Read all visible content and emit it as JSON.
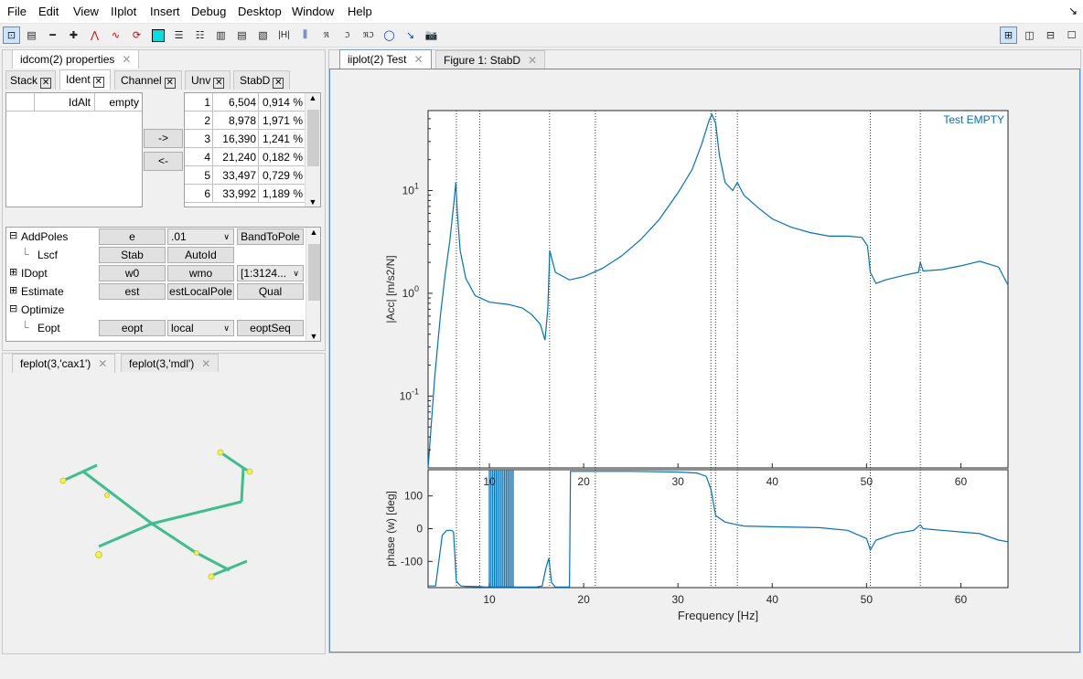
{
  "menu": [
    "File",
    "Edit",
    "View",
    "IIplot",
    "Insert",
    "Debug",
    "Desktop",
    "Window",
    "Help"
  ],
  "menu_underline_letters": [
    "F",
    "E",
    "V",
    "I",
    "I",
    "b",
    "D",
    "W",
    "H"
  ],
  "left_tabs": {
    "main": "idcom(2) properties"
  },
  "sub_tabs": [
    "Stack",
    "Ident",
    "Channel",
    "Unv",
    "StabD"
  ],
  "ident": {
    "header_col1": "IdAlt",
    "header_col2": "empty",
    "move_right": "->",
    "move_left": "<-",
    "poles": [
      {
        "idx": "1",
        "freq": "6,504",
        "damp": "0,914 %"
      },
      {
        "idx": "2",
        "freq": "8,978",
        "damp": "1,971 %"
      },
      {
        "idx": "3",
        "freq": "16,390",
        "damp": "1,241 %"
      },
      {
        "idx": "4",
        "freq": "21,240",
        "damp": "0,182 %"
      },
      {
        "idx": "5",
        "freq": "33,497",
        "damp": "0,729 %"
      },
      {
        "idx": "6",
        "freq": "33,992",
        "damp": "1,189 %"
      }
    ]
  },
  "tree": {
    "rows": [
      {
        "label": "AddPoles",
        "c1": "e",
        "c2": ".01",
        "c3": "BandToPole"
      },
      {
        "label": "Lscf",
        "c1": "Stab",
        "c2": "AutoId",
        "c3": ""
      },
      {
        "label": "IDopt",
        "c1": "w0",
        "c2": "wmo",
        "c3": "[1:3124..."
      },
      {
        "label": "Estimate",
        "c1": "est",
        "c2": "estLocalPole",
        "c3": "Qual"
      },
      {
        "label": "Optimize",
        "c1": "",
        "c2": "",
        "c3": ""
      },
      {
        "label": "Eopt",
        "c1": "eopt",
        "c2": "local",
        "c3": "eoptSeq"
      }
    ]
  },
  "fe_tabs": [
    "feplot(3,'cax1')",
    "feplot(3,'mdl')"
  ],
  "right_tabs": [
    "iiplot(2) Test",
    "Figure 1: StabD"
  ],
  "colors": {
    "curve": "#0072bd",
    "mesh": "#3cbf8f",
    "node": "#e8e830"
  },
  "chart_data": [
    {
      "type": "line",
      "title": "",
      "legend_text": "Test EMPTY",
      "ylabel": "|Acc| [m/s2/N]",
      "yscale": "log",
      "ylim": [
        0.02,
        60
      ],
      "xlim": [
        3.5,
        65
      ],
      "ytick_labels": [
        {
          "base": "10",
          "exp": "1"
        },
        {
          "base": "10",
          "exp": "0"
        },
        {
          "base": "10",
          "exp": "-1"
        }
      ],
      "pole_lines_hz": [
        6.504,
        8.978,
        16.39,
        21.24,
        33.497,
        33.992,
        36.3,
        50.4,
        55.7
      ],
      "series": [
        {
          "x": [
            3.5,
            4.2,
            4.8,
            5.3,
            5.8,
            6.2,
            6.45,
            6.6,
            6.9,
            7.5,
            8.5,
            10,
            12,
            13.5,
            14.5,
            15.4,
            15.9,
            16.2,
            16.4,
            17,
            18.5,
            20,
            22,
            24,
            26,
            28,
            30,
            31.5,
            32.5,
            33.3,
            33.6,
            34,
            34.4,
            35,
            35.8,
            36.3,
            37,
            38.5,
            40,
            42,
            44,
            46,
            48,
            49.5,
            50.1,
            50.4,
            51,
            52,
            54,
            55.5,
            55.7,
            56,
            58,
            60,
            62,
            64,
            65
          ],
          "values": [
            0.02,
            0.15,
            0.6,
            1.5,
            3.2,
            7,
            12,
            6,
            2.6,
            1.4,
            0.95,
            0.82,
            0.78,
            0.72,
            0.62,
            0.5,
            0.35,
            0.7,
            2.6,
            1.6,
            1.35,
            1.45,
            1.75,
            2.3,
            3.3,
            5.2,
            9.5,
            16,
            28,
            48,
            55,
            45,
            22,
            12,
            10,
            12,
            9,
            6.8,
            5.3,
            4.4,
            3.9,
            3.6,
            3.6,
            3.5,
            2.9,
            1.6,
            1.25,
            1.35,
            1.5,
            1.6,
            2.0,
            1.65,
            1.7,
            1.85,
            2.05,
            1.8,
            1.2
          ]
        }
      ]
    },
    {
      "type": "line",
      "title": "",
      "ylabel": "phase (w) [deg]",
      "xlabel": "Frequency [Hz]",
      "ylim": [
        -180,
        180
      ],
      "xlim": [
        3.5,
        65
      ],
      "ytick_labels": [
        "100",
        "0",
        "-100"
      ],
      "xtick_labels": [
        "10",
        "20",
        "30",
        "40",
        "50",
        "60"
      ],
      "series": [
        {
          "x": [
            3.5,
            4.3,
            5,
            5.5,
            6,
            6.2,
            6.5,
            6.8,
            7,
            7.5,
            8,
            8.5,
            9,
            9.5,
            10,
            10.5,
            11,
            12,
            13,
            14,
            15,
            15.6,
            16,
            16.3,
            16.6,
            17,
            18,
            18.5,
            18.6,
            19,
            20,
            25,
            30,
            32,
            33,
            33.5,
            34,
            35,
            36.3,
            37,
            40,
            45,
            48,
            50,
            50.4,
            51,
            53,
            55,
            55.7,
            56,
            58,
            60,
            62,
            64,
            65
          ],
          "values": [
            -175,
            -175,
            -20,
            -5,
            -5,
            -10,
            -160,
            -170,
            -175,
            -176,
            -176,
            -177,
            -177,
            -178,
            -178,
            -178,
            -178,
            -178,
            -178,
            -178,
            -178,
            -175,
            -120,
            -90,
            -165,
            -178,
            -178,
            -178,
            175,
            175,
            175,
            175,
            173,
            170,
            160,
            120,
            40,
            20,
            12,
            8,
            6,
            3,
            -5,
            -30,
            -65,
            -35,
            -15,
            -5,
            12,
            0,
            -5,
            -10,
            -15,
            -35,
            -40
          ]
        }
      ]
    }
  ]
}
